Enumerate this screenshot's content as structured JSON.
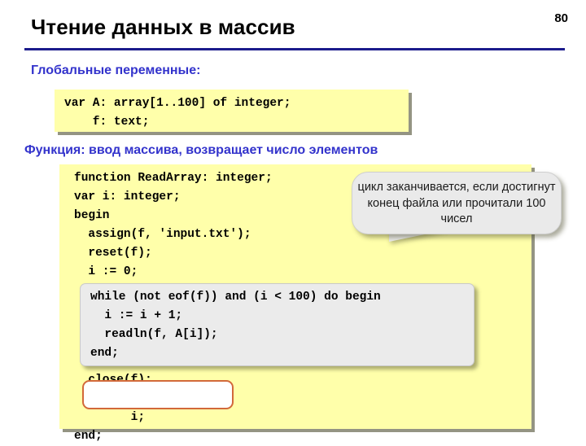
{
  "slide": {
    "title": "Чтение данных в массив",
    "page_number": "80",
    "rule_color": "#1c1c8c"
  },
  "headings": {
    "globals": "Глобальные переменные:",
    "function": "Функция: ввод массива, возвращает число элементов",
    "color": "#3333cc"
  },
  "code_globals": {
    "panel_color": "#ffffaa",
    "text": "var A: array[1..100] of integer;\n    f: text;"
  },
  "code_function": {
    "panel_color": "#ffffaa",
    "text_top": "function ReadArray: integer;\nvar i: integer;\nbegin\n  assign(f, 'input.txt');\n  reset(f);\n  i := 0;",
    "text_bottom": "  close(f);\n  ReadArray :=\n        i;\nend;"
  },
  "while_block": {
    "background_color": "#ebebeb",
    "text": "while (not eof(f)) and (i < 100) do begin\n  i := i + 1;\n  readln(f, A[i]);\nend;"
  },
  "return_box": {
    "border_color": "#d2693a",
    "background_color": "#ffffff"
  },
  "callout": {
    "background_color": "#eaeaea",
    "text": "цикл заканчивается, если достигнут конец файла или прочитали 100 чисел"
  }
}
